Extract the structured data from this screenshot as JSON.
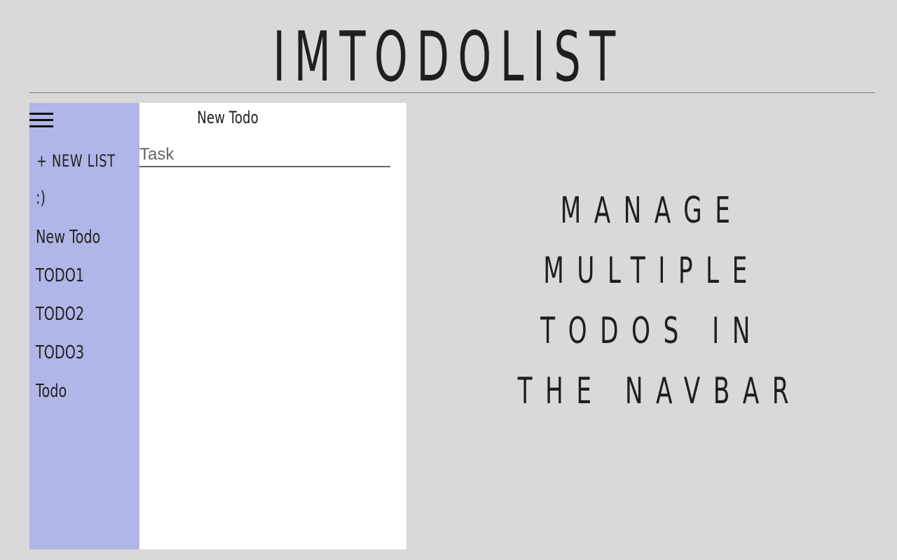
{
  "header": {
    "title": "IMTODOLIST"
  },
  "sidebar": {
    "menu_icon": "hamburger-menu-icon",
    "new_list_label": "+ NEW LIST",
    "items": [
      {
        "label": ":)"
      },
      {
        "label": "New Todo"
      },
      {
        "label": "TODO1"
      },
      {
        "label": "TODO2"
      },
      {
        "label": "TODO3"
      },
      {
        "label": "Todo"
      }
    ]
  },
  "main": {
    "list_title": "New Todo",
    "task_input": {
      "placeholder": "Task",
      "value": ""
    }
  },
  "tagline": {
    "lines": [
      "MANAGE",
      "MULTIPLE",
      "TODOS IN",
      "THE NAVBAR"
    ]
  },
  "colors": {
    "background": "#d9d9d9",
    "sidebar": "#b1b6e8",
    "panel": "#ffffff",
    "text": "#1f1f1f"
  }
}
